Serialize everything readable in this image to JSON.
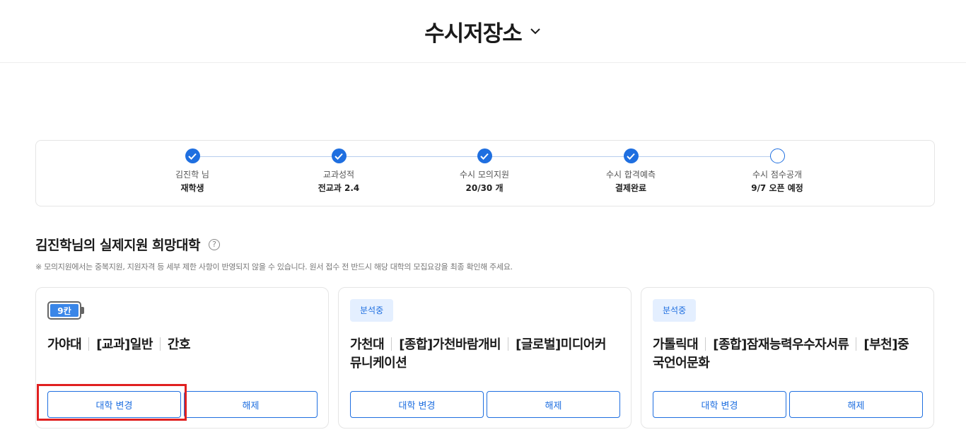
{
  "header": {
    "title": "수시저장소"
  },
  "progress": {
    "steps": [
      {
        "label": "김진학 님",
        "value": "재학생",
        "done": true
      },
      {
        "label": "교과성적",
        "value": "전교과 2.4",
        "done": true
      },
      {
        "label": "수시 모의지원",
        "value": "20/30 개",
        "done": true
      },
      {
        "label": "수시 합격예측",
        "value": "결제완료",
        "done": true
      },
      {
        "label": "수시 점수공개",
        "value": "9/7 오픈 예정",
        "done": false
      }
    ]
  },
  "section": {
    "title": "김진학님의 실제지원 희망대학",
    "help_icon": "?",
    "notice": "※ 모의지원에서는 중복지원, 지원자격 등 세부 제한 사항이 반영되지 않을 수 있습니다. 원서 접수 전 반드시 해당 대학의 모집요강을 최종 확인해 주세요."
  },
  "cards": [
    {
      "badge_type": "battery",
      "badge": "9칸",
      "name_parts": [
        "가야대",
        "[교과]일반",
        "간호"
      ],
      "change_label": "대학 변경",
      "remove_label": "해제"
    },
    {
      "badge_type": "status",
      "badge": "분석중",
      "name_parts": [
        "가천대",
        "[종합]가천바람개비",
        "[글로벌]미디어커뮤니케이션"
      ],
      "change_label": "대학 변경",
      "remove_label": "해제"
    },
    {
      "badge_type": "status",
      "badge": "분석중",
      "name_parts": [
        "가톨릭대",
        "[종합]잠재능력우수자서류",
        "[부천]중국언어문화"
      ],
      "change_label": "대학 변경",
      "remove_label": "해제"
    }
  ],
  "colors": {
    "accent": "#1f6fe0",
    "highlight": "#e02020"
  }
}
